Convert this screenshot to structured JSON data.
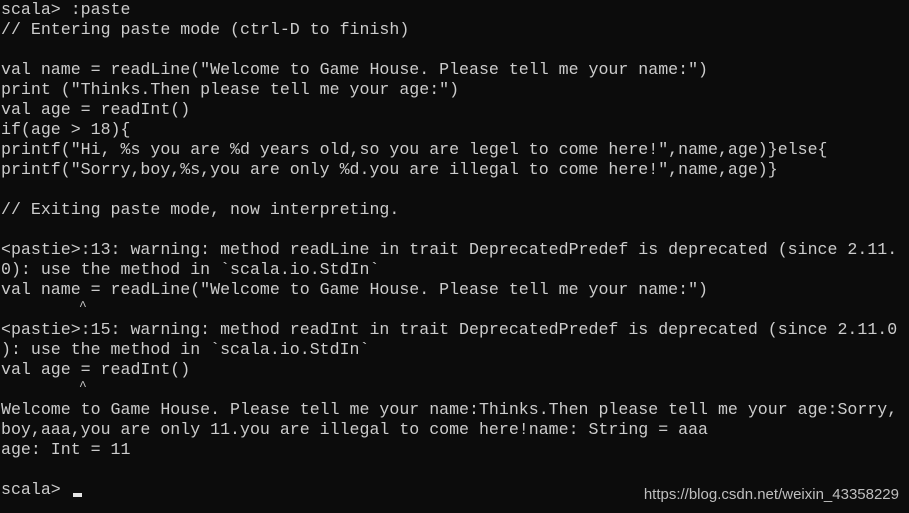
{
  "terminal": {
    "lines": [
      "scala> :paste",
      "// Entering paste mode (ctrl-D to finish)",
      "",
      "val name = readLine(\"Welcome to Game House. Please tell me your name:\")",
      "print (\"Thinks.Then please tell me your age:\")",
      "val age = readInt()",
      "if(age > 18){",
      "printf(\"Hi, %s you are %d years old,so you are legel to come here!\",name,age)}else{",
      "printf(\"Sorry,boy,%s,you are only %d.you are illegal to come here!\",name,age)}",
      "",
      "// Exiting paste mode, now interpreting.",
      "",
      "<pastie>:13: warning: method readLine in trait DeprecatedPredef is deprecated (since 2.11.",
      "0): use the method in `scala.io.StdIn`",
      "val name = readLine(\"Welcome to Game House. Please tell me your name:\")",
      "          ^",
      "<pastie>:15: warning: method readInt in trait DeprecatedPredef is deprecated (since 2.11.0",
      "): use the method in `scala.io.StdIn`",
      "val age = readInt()",
      "          ^",
      "Welcome to Game House. Please tell me your name:Thinks.Then please tell me your age:Sorry,",
      "boy,aaa,you are only 11.you are illegal to come here!name: String = aaa",
      "age: Int = 11",
      ""
    ],
    "prompt": "scala> ",
    "watermark": "https://blog.csdn.net/weixin_43358229"
  }
}
